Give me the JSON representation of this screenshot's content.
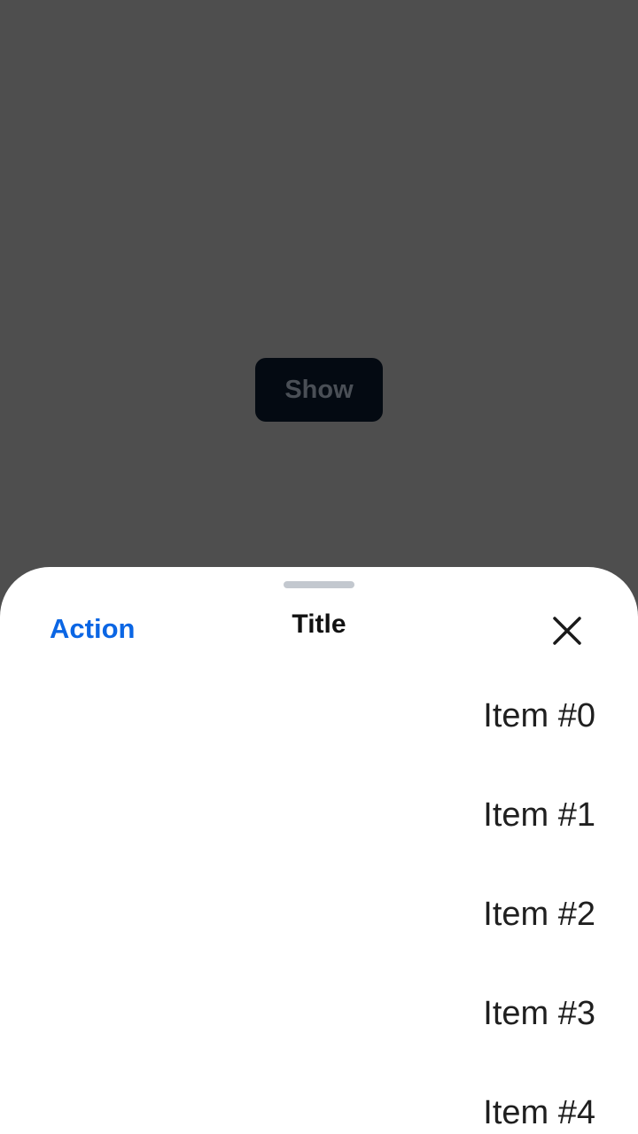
{
  "background": {
    "show_label": "Show"
  },
  "sheet": {
    "action_label": "Action",
    "title": "Title",
    "close_icon": "close-icon",
    "items": [
      {
        "label": "Item #0"
      },
      {
        "label": "Item #1"
      },
      {
        "label": "Item #2"
      },
      {
        "label": "Item #3"
      },
      {
        "label": "Item #4"
      }
    ]
  },
  "colors": {
    "scrim": "#4e4e4e",
    "action": "#0b66e4",
    "handle": "#c3c8cf",
    "show_button_bg": "#040a12"
  }
}
